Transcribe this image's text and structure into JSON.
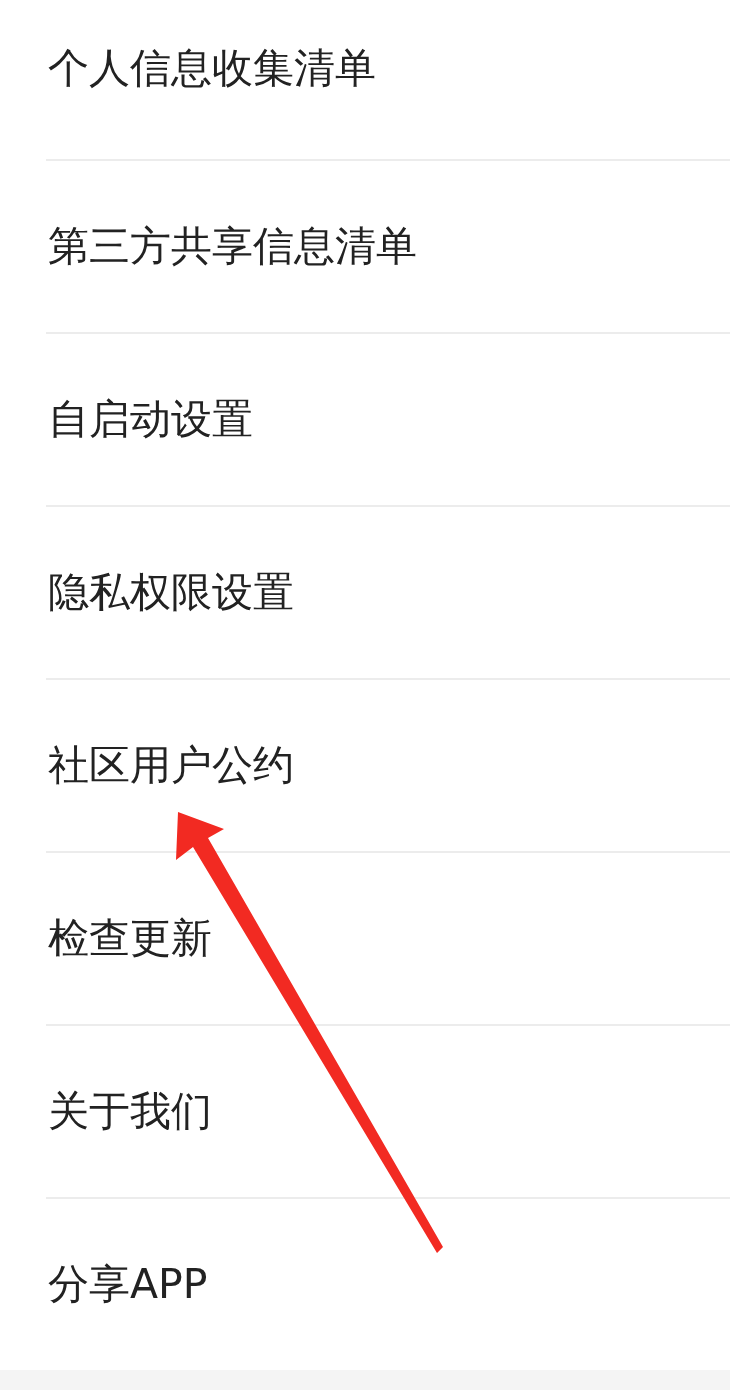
{
  "menu_items": [
    {
      "label": "个人信息收集清单"
    },
    {
      "label": "第三方共享信息清单"
    },
    {
      "label": "自启动设置"
    },
    {
      "label": "隐私权限设置"
    },
    {
      "label": "社区用户公约"
    },
    {
      "label": "检查更新"
    },
    {
      "label": "关于我们"
    },
    {
      "label": "分享APP"
    }
  ]
}
